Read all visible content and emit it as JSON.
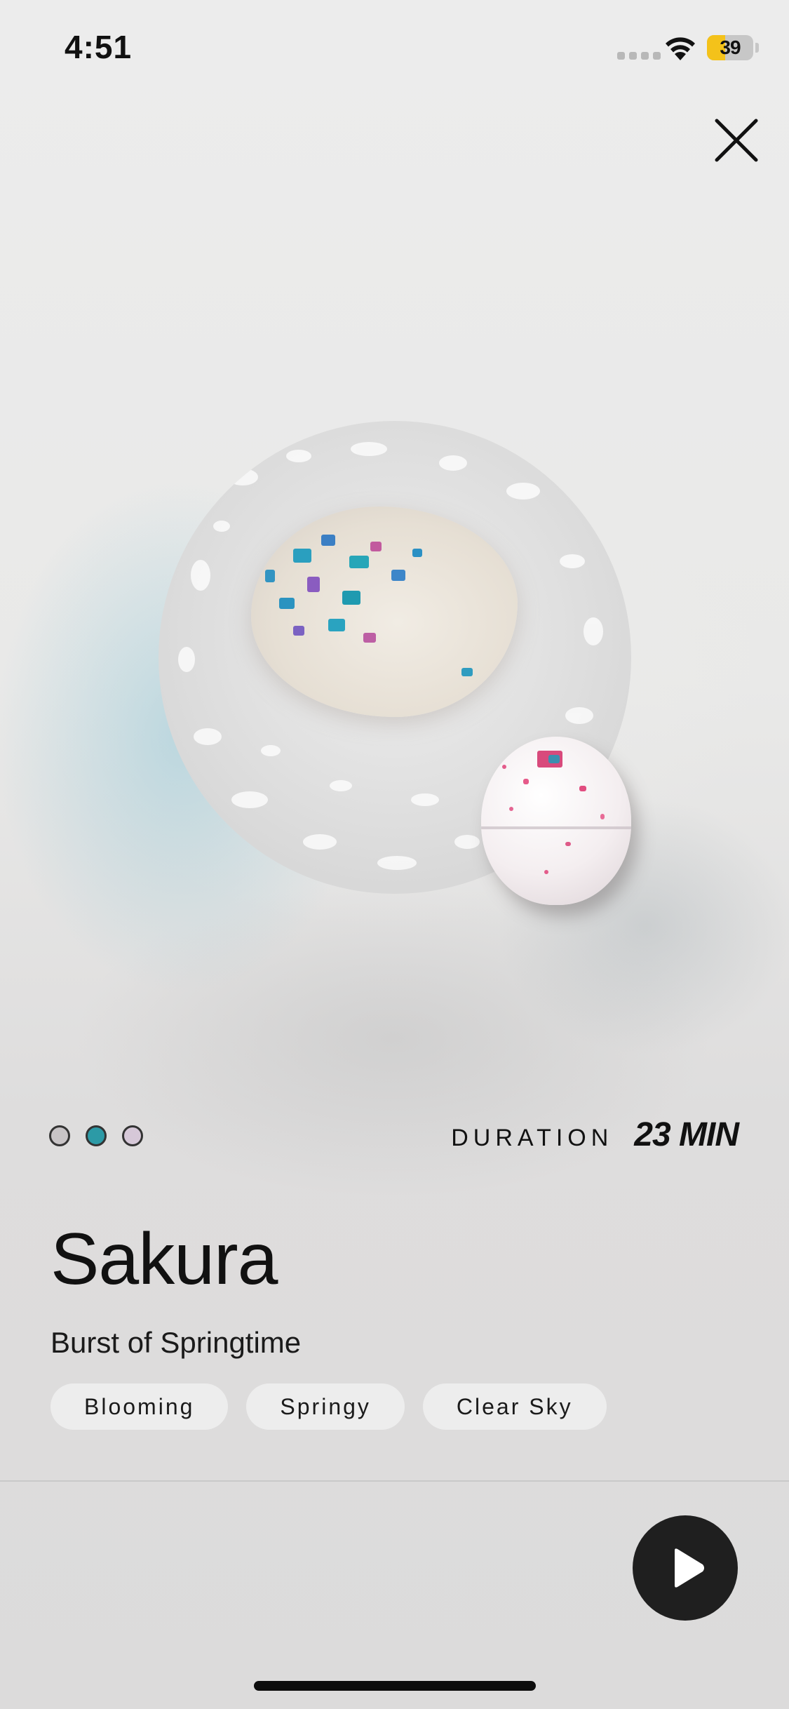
{
  "status_bar": {
    "time": "4:51",
    "battery": "39",
    "battery_level": 0.39
  },
  "close": {
    "icon": "close-icon"
  },
  "hero": {
    "alt": "bath bomb dissolving in water"
  },
  "pager": {
    "dots": [
      {
        "color": "#c8c4c6",
        "active": false
      },
      {
        "color": "#2c9aa6",
        "active": true
      },
      {
        "color": "#d6c8d8",
        "active": false
      }
    ]
  },
  "duration": {
    "label": "DURATION",
    "value": "23 MIN"
  },
  "product": {
    "title": "Sakura",
    "subtitle": "Burst of Springtime",
    "tags": [
      "Blooming",
      "Springy",
      "Clear Sky"
    ]
  },
  "player": {
    "icon": "play-icon"
  },
  "colors": {
    "accent": "#2c9aa6",
    "play_button": "#1f1f1f",
    "tag_bg": "#f0f0f0"
  }
}
